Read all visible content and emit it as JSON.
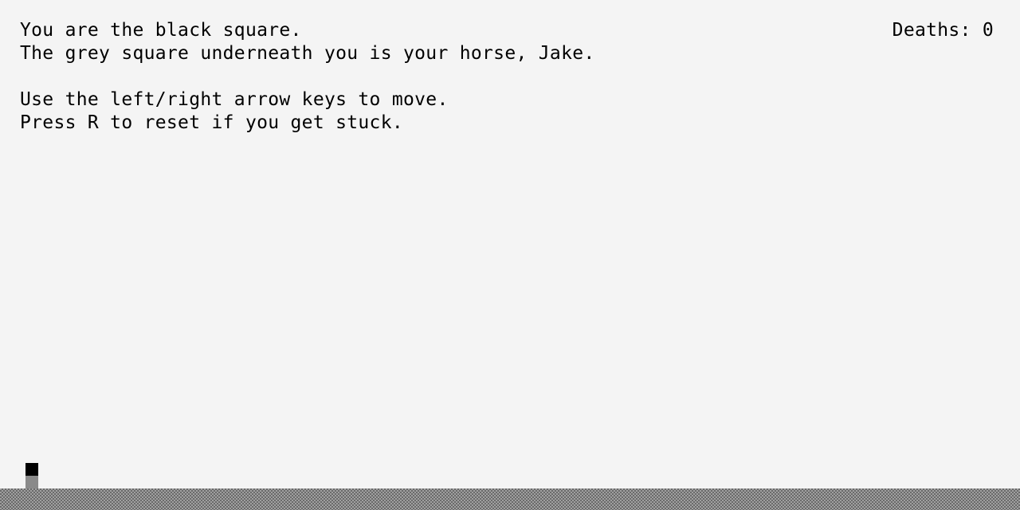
{
  "instructions": {
    "line1": "You are the black square.",
    "line2": "The grey square underneath you is your horse, Jake.",
    "line3": "Use the left/right arrow keys to move.",
    "line4": "Press R to reset if you get stuck."
  },
  "hud": {
    "deaths_text": "Deaths: 0"
  },
  "colors": {
    "background": "#f4f4f4",
    "player": "#000000",
    "horse": "#8a8a8a",
    "ground": "#a0a0a0"
  }
}
